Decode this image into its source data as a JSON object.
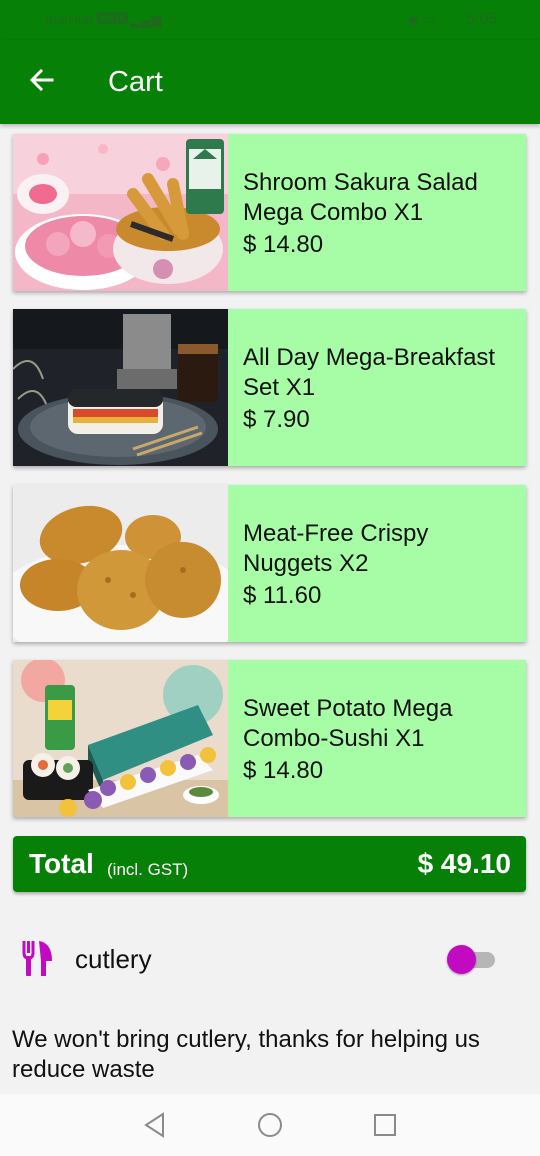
{
  "status_bar": {
    "carrier": "StarHub",
    "volte": "VoLTE",
    "time": "5:05"
  },
  "header": {
    "title": "Cart",
    "back_icon": "arrow-left-icon"
  },
  "cart_items": [
    {
      "name": "Shroom Sakura Salad Mega Combo X1",
      "price": "$ 14.80",
      "image": "combo-bowl-photo"
    },
    {
      "name": "All Day Mega-Breakfast Set X1",
      "price": "$ 7.90",
      "image": "breakfast-sandwich-photo"
    },
    {
      "name": "Meat-Free Crispy Nuggets X2",
      "price": "$ 11.60",
      "image": "nuggets-photo"
    },
    {
      "name": "Sweet Potato Mega Combo-Sushi X1",
      "price": "$ 14.80",
      "image": "sushi-box-photo"
    }
  ],
  "total": {
    "label": "Total",
    "note": "(incl. GST)",
    "amount": "$ 49.10"
  },
  "cutlery": {
    "label": "cutlery",
    "icon": "fork-knife-icon",
    "enabled": false,
    "message": "We won't bring cutlery, thanks for helping us reduce waste"
  },
  "colors": {
    "primary_green": "#078007",
    "card_green": "#a7fca6",
    "toggle_accent": "#c30ac3"
  },
  "nav_bar": {
    "icons": [
      "back-triangle-icon",
      "home-circle-icon",
      "recents-square-icon"
    ]
  }
}
